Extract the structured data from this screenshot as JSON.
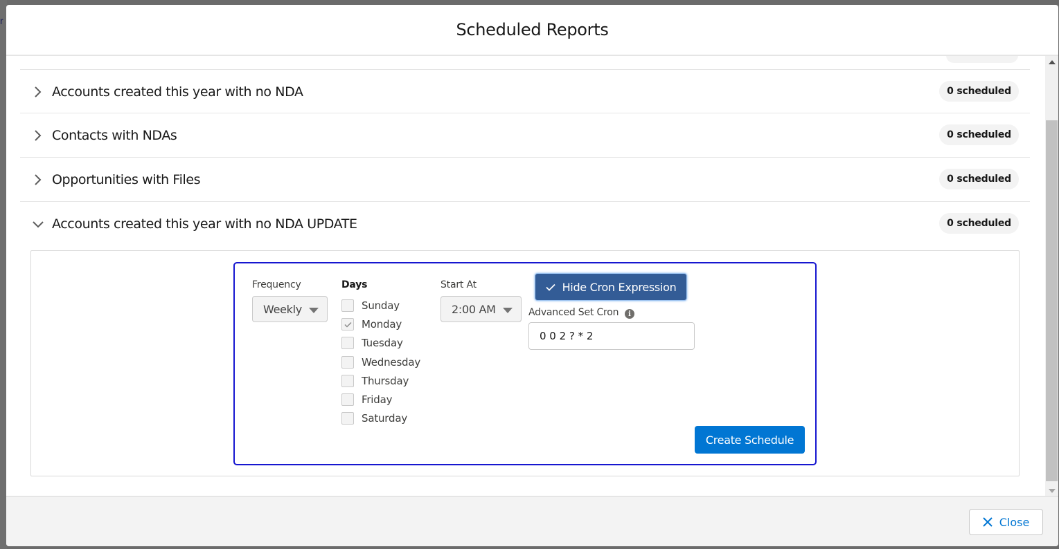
{
  "modal": {
    "title": "Scheduled Reports"
  },
  "reports": [
    {
      "title": "Accounts created this year with no NDA",
      "badge": "0 scheduled",
      "expanded": false
    },
    {
      "title": "Contacts with NDAs",
      "badge": "0 scheduled",
      "expanded": false
    },
    {
      "title": "Opportunities with Files",
      "badge": "0 scheduled",
      "expanded": false
    },
    {
      "title": "Accounts created this year with no NDA UPDATE",
      "badge": "0 scheduled",
      "expanded": true
    }
  ],
  "schedule_form": {
    "frequency": {
      "label": "Frequency",
      "value": "Weekly"
    },
    "days": {
      "label": "Days",
      "options": [
        {
          "label": "Sunday",
          "checked": false
        },
        {
          "label": "Monday",
          "checked": true
        },
        {
          "label": "Tuesday",
          "checked": false
        },
        {
          "label": "Wednesday",
          "checked": false
        },
        {
          "label": "Thursday",
          "checked": false
        },
        {
          "label": "Friday",
          "checked": false
        },
        {
          "label": "Saturday",
          "checked": false
        }
      ]
    },
    "start_at": {
      "label": "Start At",
      "value": "2:00 AM"
    },
    "cron_toggle_label": "Hide Cron Expression",
    "advanced_cron": {
      "label": "Advanced Set Cron",
      "value": "0 0 2 ? * 2",
      "info_icon": "info-icon"
    },
    "create_label": "Create Schedule"
  },
  "footer": {
    "close_label": "Close"
  },
  "colors": {
    "brand_blue": "#0176d3",
    "cron_button": "#335c96",
    "form_focus_border": "#1616d0"
  }
}
